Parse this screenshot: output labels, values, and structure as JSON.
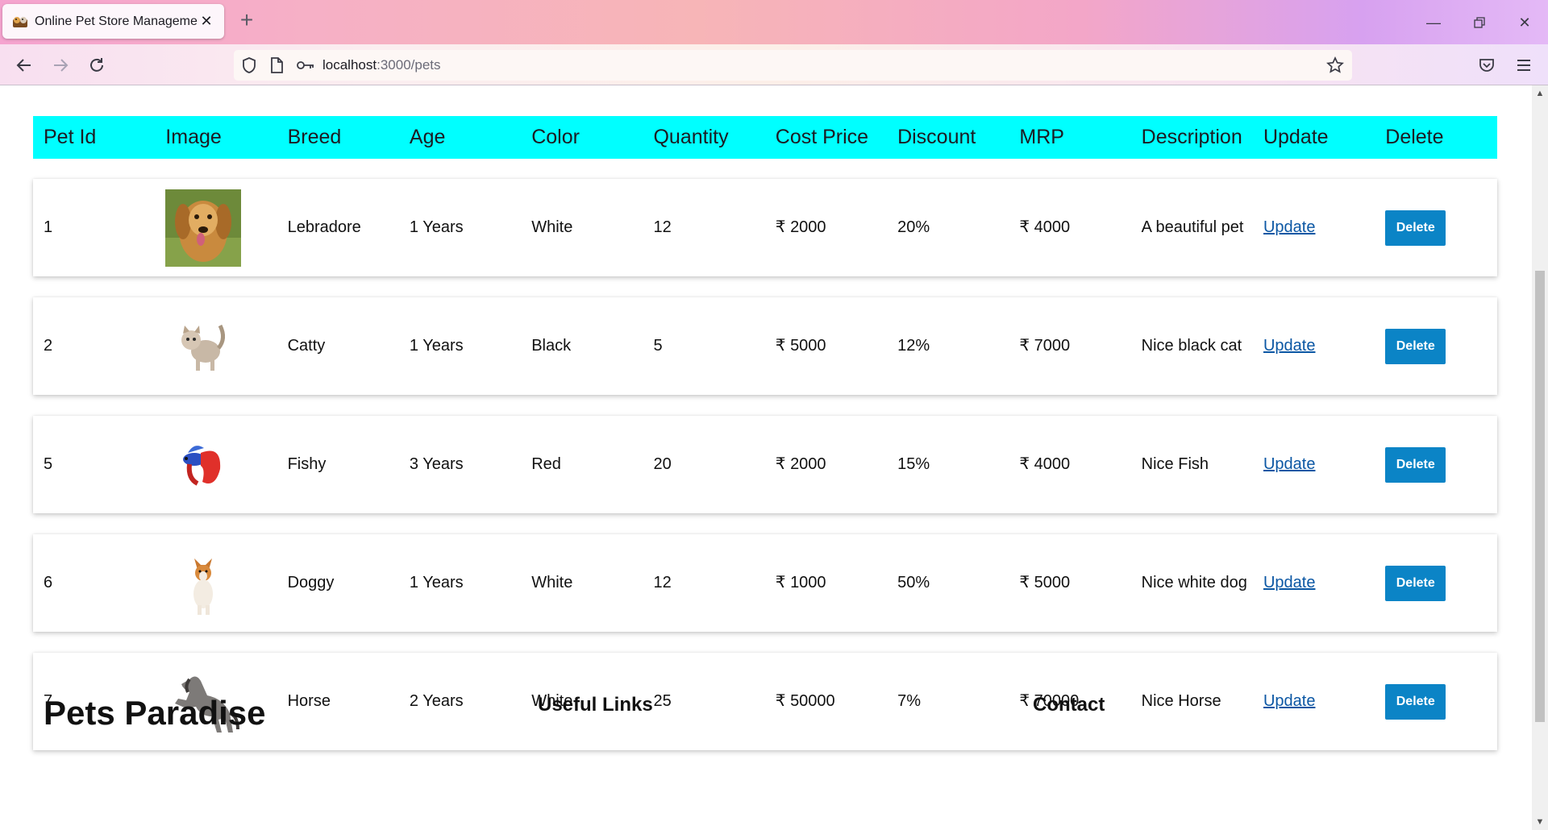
{
  "browser": {
    "tab_title": "Online Pet Store Management",
    "url_host": "localhost",
    "url_path": ":3000/pets"
  },
  "table": {
    "headers": [
      "Pet Id",
      "Image",
      "Breed",
      "Age",
      "Color",
      "Quantity",
      "Cost Price",
      "Discount",
      "MRP",
      "Description",
      "Update",
      "Delete"
    ],
    "rows": [
      {
        "id": "1",
        "image": "golden-retriever-photo",
        "breed": "Lebradore",
        "age": "1 Years",
        "color": "White",
        "quantity": "12",
        "cost": "₹ 2000",
        "discount": "20%",
        "mrp": "₹ 4000",
        "description": "A beautiful pet",
        "update": "Update",
        "delete": "Delete"
      },
      {
        "id": "2",
        "image": "kitten-photo",
        "breed": "Catty",
        "age": "1 Years",
        "color": "Black",
        "quantity": "5",
        "cost": "₹ 5000",
        "discount": "12%",
        "mrp": "₹ 7000",
        "description": "Nice black cat",
        "update": "Update",
        "delete": "Delete"
      },
      {
        "id": "5",
        "image": "betta-fish-photo",
        "breed": "Fishy",
        "age": "3 Years",
        "color": "Red",
        "quantity": "20",
        "cost": "₹ 2000",
        "discount": "15%",
        "mrp": "₹ 4000",
        "description": "Nice Fish",
        "update": "Update",
        "delete": "Delete"
      },
      {
        "id": "6",
        "image": "corgi-photo",
        "breed": "Doggy",
        "age": "1 Years",
        "color": "White",
        "quantity": "12",
        "cost": "₹ 1000",
        "discount": "50%",
        "mrp": "₹ 5000",
        "description": "Nice white dog",
        "update": "Update",
        "delete": "Delete"
      },
      {
        "id": "7",
        "image": "horse-photo",
        "breed": "Horse",
        "age": "2 Years",
        "color": "White",
        "quantity": "25",
        "cost": "₹ 50000",
        "discount": "7%",
        "mrp": "₹ 70000",
        "description": "Nice Horse",
        "update": "Update",
        "delete": "Delete"
      }
    ]
  },
  "footer": {
    "brand": "Pets Paradise",
    "useful_links": "Useful Links",
    "contact": "Contact"
  },
  "colors": {
    "header_bg": "#00ffff",
    "delete_button": "#0b84c6",
    "link": "#0b57a4"
  }
}
